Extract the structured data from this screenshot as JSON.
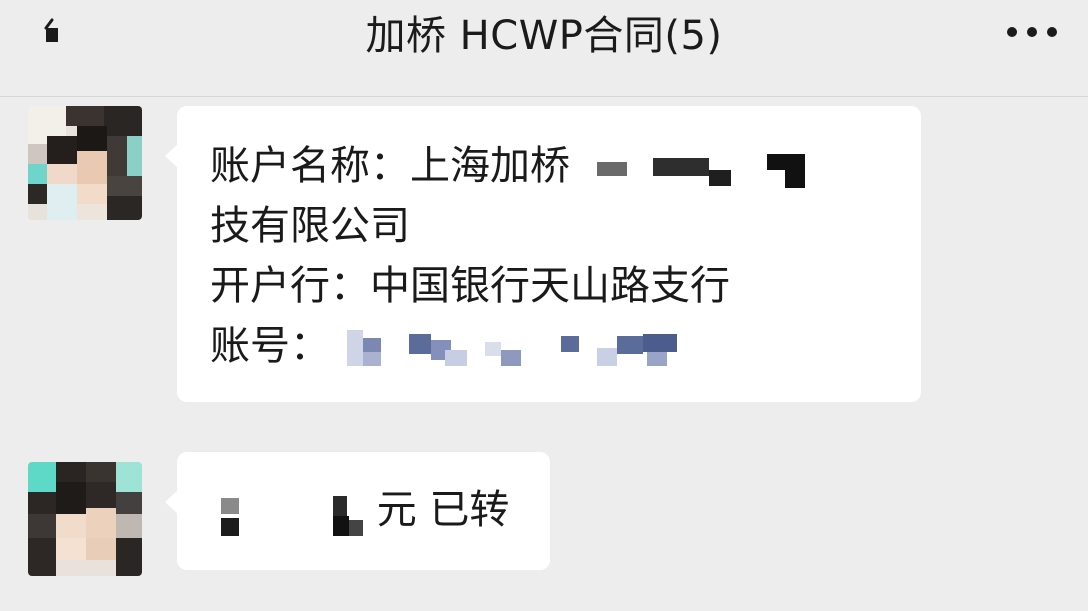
{
  "header": {
    "title": "加桥 HCWP合同(5)",
    "back_icon": "back-arrow-icon",
    "more_icon": "more-dots-icon"
  },
  "messages": [
    {
      "sender_avatar": "avatar-1",
      "lines": [
        {
          "text": "账户名称：上海加桥",
          "redacted_suffix": true
        },
        {
          "text": "技有限公司"
        },
        {
          "text": "开户行：中国银行天山路支行"
        },
        {
          "text": "账号：",
          "redacted_suffix": true
        }
      ]
    },
    {
      "sender_avatar": "avatar-2",
      "lines": [
        {
          "prefix_redacted": true,
          "text": "元 已转"
        }
      ]
    }
  ],
  "colors": {
    "background": "#ededed",
    "bubble": "#ffffff",
    "text": "#1a1a1a",
    "account_mosaic": "#5b6b9a"
  }
}
